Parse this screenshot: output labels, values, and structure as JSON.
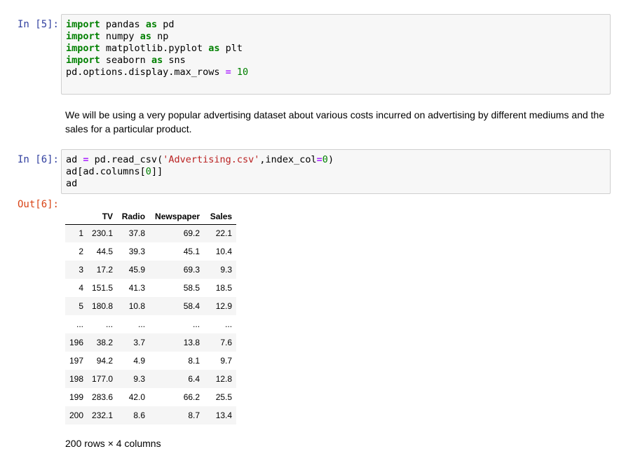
{
  "cells": [
    {
      "prompt": "In [5]:",
      "lines": [
        [
          {
            "t": "import",
            "c": "kw"
          },
          {
            "t": " pandas ",
            "c": ""
          },
          {
            "t": "as",
            "c": "kw"
          },
          {
            "t": " pd",
            "c": ""
          }
        ],
        [
          {
            "t": "import",
            "c": "kw"
          },
          {
            "t": " numpy ",
            "c": ""
          },
          {
            "t": "as",
            "c": "kw"
          },
          {
            "t": " np",
            "c": ""
          }
        ],
        [
          {
            "t": "import",
            "c": "kw"
          },
          {
            "t": " matplotlib.pyplot ",
            "c": ""
          },
          {
            "t": "as",
            "c": "kw"
          },
          {
            "t": " plt",
            "c": ""
          }
        ],
        [
          {
            "t": "import",
            "c": "kw"
          },
          {
            "t": " seaborn ",
            "c": ""
          },
          {
            "t": "as",
            "c": "kw"
          },
          {
            "t": " sns",
            "c": ""
          }
        ],
        [
          {
            "t": "pd.options.display.max_rows ",
            "c": ""
          },
          {
            "t": "=",
            "c": "op"
          },
          {
            "t": " ",
            "c": ""
          },
          {
            "t": "10",
            "c": "num"
          }
        ]
      ]
    },
    {
      "prompt": "In [6]:",
      "lines": [
        [
          {
            "t": "ad ",
            "c": ""
          },
          {
            "t": "=",
            "c": "op"
          },
          {
            "t": " pd.read_csv(",
            "c": ""
          },
          {
            "t": "'Advertising.csv'",
            "c": "str"
          },
          {
            "t": ",index_col",
            "c": ""
          },
          {
            "t": "=",
            "c": "op"
          },
          {
            "t": "0",
            "c": "num"
          },
          {
            "t": ")",
            "c": ""
          }
        ],
        [
          {
            "t": "ad[ad.columns[",
            "c": ""
          },
          {
            "t": "0",
            "c": "num"
          },
          {
            "t": "]]",
            "c": ""
          }
        ],
        [
          {
            "t": "ad",
            "c": ""
          }
        ]
      ]
    }
  ],
  "markdown_text": "We will be using a very popular advertising dataset about various costs incurred on advertising by different mediums and the sales for a particular product.",
  "output_prompt": "Out[6]:",
  "table": {
    "columns": [
      "TV",
      "Radio",
      "Newspaper",
      "Sales"
    ],
    "rows": [
      [
        "1",
        "230.1",
        "37.8",
        "69.2",
        "22.1"
      ],
      [
        "2",
        "44.5",
        "39.3",
        "45.1",
        "10.4"
      ],
      [
        "3",
        "17.2",
        "45.9",
        "69.3",
        "9.3"
      ],
      [
        "4",
        "151.5",
        "41.3",
        "58.5",
        "18.5"
      ],
      [
        "5",
        "180.8",
        "10.8",
        "58.4",
        "12.9"
      ],
      [
        "...",
        "...",
        "...",
        "...",
        "..."
      ],
      [
        "196",
        "38.2",
        "3.7",
        "13.8",
        "7.6"
      ],
      [
        "197",
        "94.2",
        "4.9",
        "8.1",
        "9.7"
      ],
      [
        "198",
        "177.0",
        "9.3",
        "6.4",
        "12.8"
      ],
      [
        "199",
        "283.6",
        "42.0",
        "66.2",
        "25.5"
      ],
      [
        "200",
        "232.1",
        "8.6",
        "8.7",
        "13.4"
      ]
    ]
  },
  "shape_text": "200 rows × 4 columns",
  "colors": {
    "in_prompt": "#303f9f",
    "out_prompt": "#d84315",
    "keyword": "#008000",
    "operator": "#aa22ff",
    "string": "#ba2121",
    "code_bg": "#f7f7f7"
  }
}
